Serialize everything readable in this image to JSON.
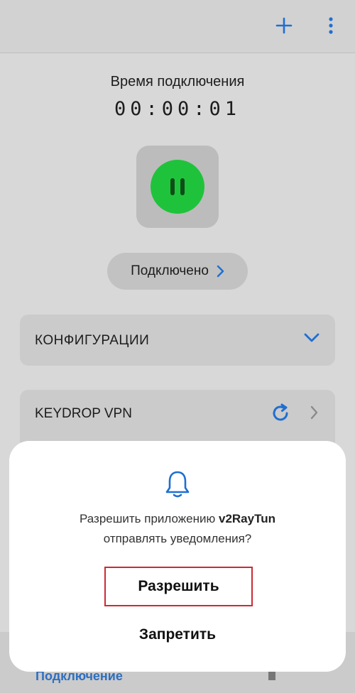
{
  "header": {
    "add_icon": "plus-icon",
    "menu_icon": "more-vert-icon"
  },
  "connection": {
    "label": "Время подключения",
    "timer": "00:00:01",
    "status": "Подключено"
  },
  "configs": {
    "title": "КОНФИГУРАЦИИ"
  },
  "server": {
    "name": "KEYDROP VPN"
  },
  "bottom_nav": {
    "tab": "Подключение"
  },
  "dialog": {
    "message_prefix": "Разрешить приложению ",
    "app_name": "v2RayTun",
    "message_suffix": "отправлять уведомления?",
    "allow": "Разрешить",
    "deny": "Запретить"
  },
  "colors": {
    "accent": "#1f6fd1",
    "connected": "#1fc33b",
    "highlight": "#cc2a36"
  }
}
